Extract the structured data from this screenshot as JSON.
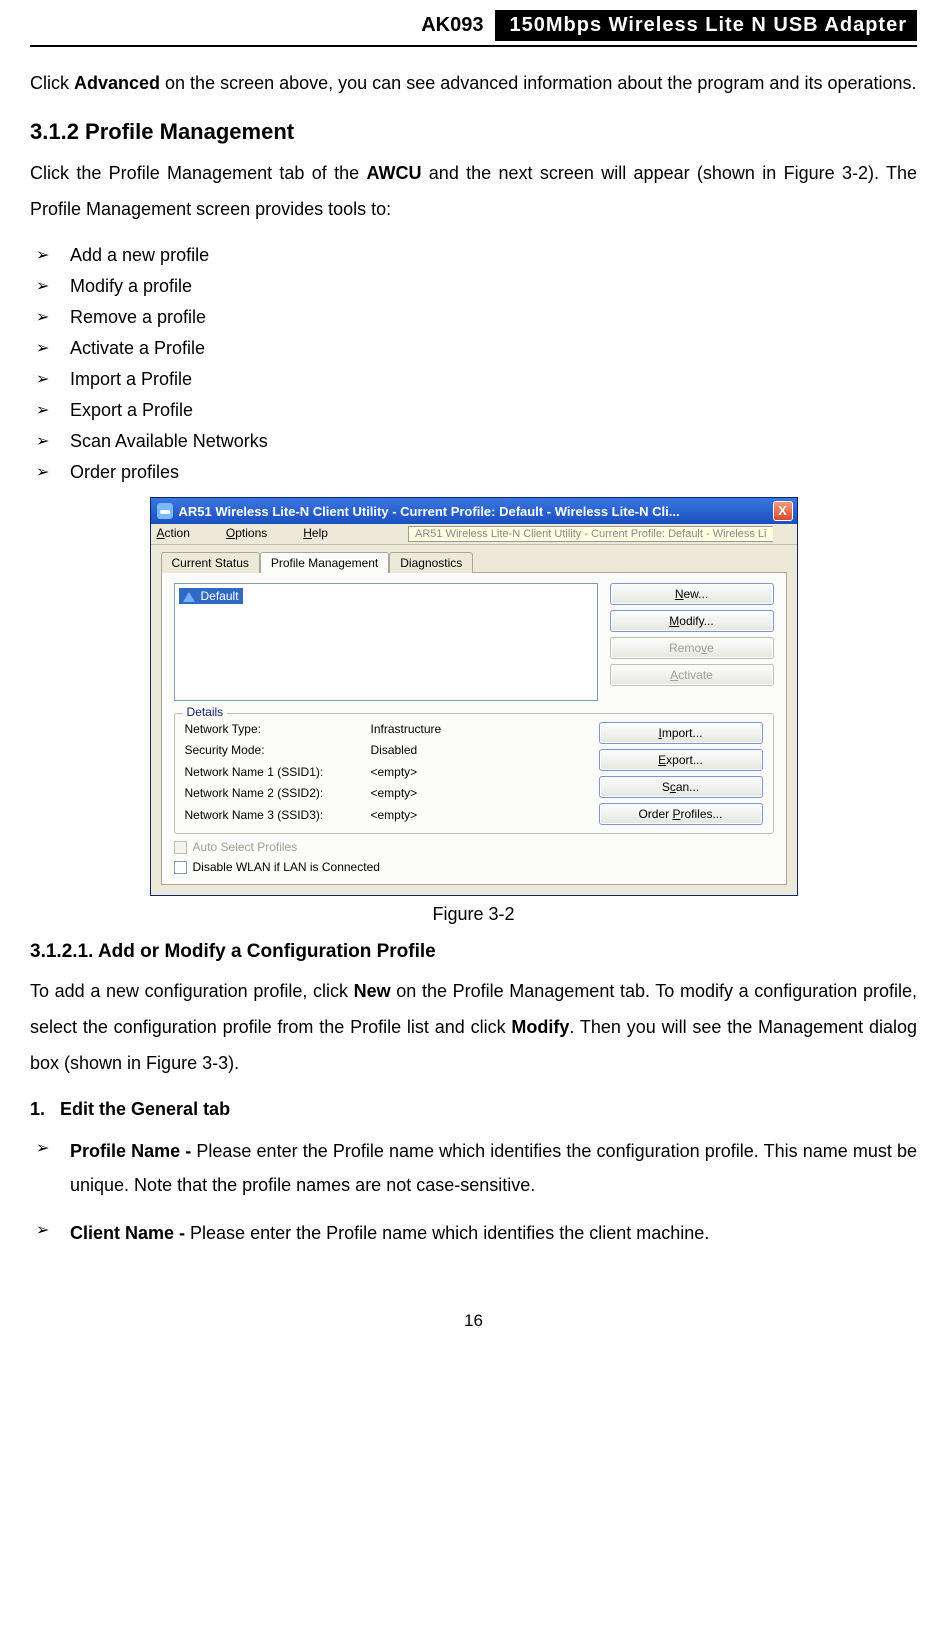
{
  "header": {
    "code": "AK093",
    "title": "150Mbps Wireless Lite N USB Adapter"
  },
  "intro": {
    "sentence_prefix": "Click ",
    "bold": "Advanced",
    "sentence_suffix": " on the screen above, you can see advanced information about the program and its operations."
  },
  "section_312": {
    "heading": "3.1.2   Profile Management",
    "para_prefix": "Click the Profile Management tab of the ",
    "para_bold": "AWCU",
    "para_suffix": " and the next screen will appear (shown in Figure 3-2). The Profile Management screen provides tools to:",
    "bullets": [
      "Add a new profile",
      "Modify a profile",
      "Remove a profile",
      "Activate a Profile",
      "Import a Profile",
      "Export a Profile",
      "Scan Available Networks",
      "Order profiles"
    ]
  },
  "window": {
    "title": "AR51 Wireless Lite-N Client Utility - Current Profile: Default - Wireless Lite-N Cli...",
    "tooltip": "AR51 Wireless Lite-N Client Utility - Current Profile: Default - Wireless Li",
    "close": "X",
    "menus": {
      "action": "Action",
      "options": "Options",
      "help": "Help"
    },
    "tabs": {
      "current": "Current Status",
      "pm": "Profile Management",
      "diag": "Diagnostics"
    },
    "profile_item": "Default",
    "buttons": {
      "new": "New...",
      "modify": "Modify...",
      "remove": "Remove",
      "activate": "Activate",
      "import": "Import...",
      "export": "Export...",
      "scan": "Scan...",
      "order": "Order Profiles..."
    },
    "details": {
      "legend": "Details",
      "rows": [
        {
          "k": "Network Type:",
          "v": "Infrastructure"
        },
        {
          "k": "Security Mode:",
          "v": "Disabled"
        },
        {
          "k": "Network Name 1 (SSID1):",
          "v": "<empty>"
        },
        {
          "k": "Network Name 2 (SSID2):",
          "v": "<empty>"
        },
        {
          "k": "Network Name 3 (SSID3):",
          "v": "<empty>"
        }
      ]
    },
    "checks": {
      "auto": "Auto Select Profiles",
      "disable_wlan": "Disable WLAN if LAN is Connected"
    }
  },
  "caption": "Figure 3-2",
  "section_31211": {
    "heading": "3.1.2.1.   Add or Modify a Configuration Profile",
    "para_p1": "To add a new configuration profile, click ",
    "para_b1": "New",
    "para_p2": " on the Profile Management tab. To modify a configuration profile, select the configuration profile from the Profile list and click ",
    "para_b2": "Modify",
    "para_p3": ". Then you will see the Management dialog box (shown in Figure 3-3).",
    "num_label": "1.",
    "num_text": "Edit the General tab",
    "bullets": [
      {
        "bold": "Profile Name - ",
        "rest": "Please enter the Profile name which identifies the configuration profile. This name must be unique. Note that the profile names are not case-sensitive."
      },
      {
        "bold": "Client Name - ",
        "rest": "Please enter the Profile name which identifies the client machine."
      }
    ]
  },
  "pagenum": "16"
}
